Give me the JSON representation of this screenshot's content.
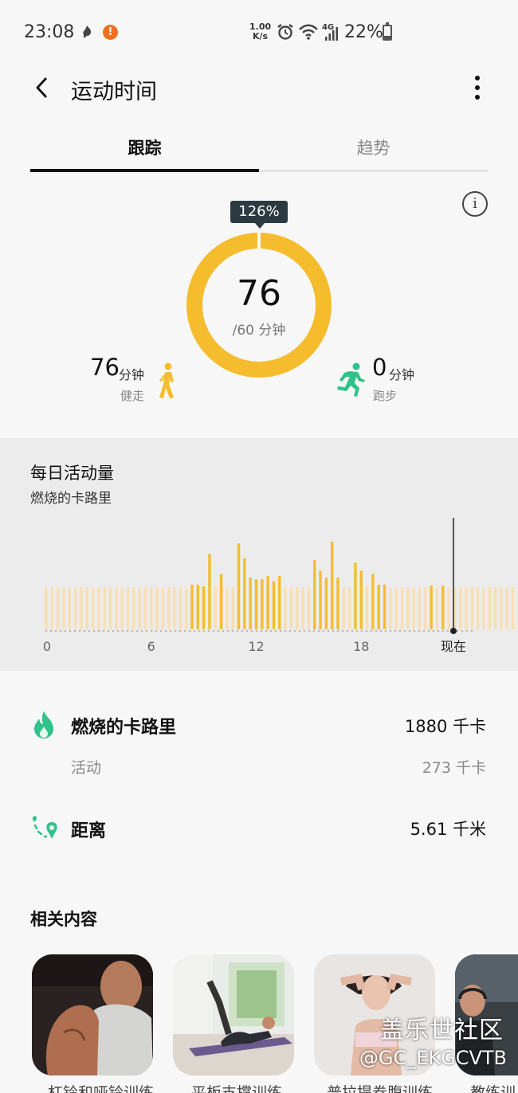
{
  "status_bar": {
    "time": "23:08",
    "speed_value": "1.00",
    "speed_unit": "K/s",
    "network": "4G",
    "battery_percent": "22%",
    "battery_level": 0.22,
    "alert_glyph": "!"
  },
  "header": {
    "title": "运动时间",
    "back_icon": "chevron-left-icon",
    "menu_icon": "more-vertical-icon"
  },
  "tabs": [
    {
      "label": "跟踪",
      "active": true
    },
    {
      "label": "趋势",
      "active": false
    }
  ],
  "summary": {
    "percent_badge": "126%",
    "value": "76",
    "goal": "/60 分钟",
    "progress": 1.26,
    "info_glyph": "i",
    "walk": {
      "value": "76",
      "unit": "分钟",
      "label": "健走"
    },
    "run": {
      "value": "0",
      "unit": "分钟",
      "label": "跑步"
    },
    "colors": {
      "ring": "#f5bd2e",
      "walk_icon": "#f5bd2e",
      "run_icon": "#2fc28a",
      "badge": "#2c3a42"
    }
  },
  "daily_activity": {
    "title": "每日活动量",
    "subtitle": "燃烧的卡路里",
    "chart_data": {
      "type": "bar",
      "x_tick_labels": [
        "0",
        "6",
        "12",
        "18",
        "现在"
      ],
      "x_ticks_hours": [
        0,
        6,
        12,
        18,
        23
      ],
      "bar_interval_minutes": 20,
      "bar_heights_relative": [
        0.48,
        0.48,
        0.48,
        0.48,
        0.48,
        0.48,
        0.48,
        0.48,
        0.48,
        0.48,
        0.48,
        0.48,
        0.48,
        0.48,
        0.48,
        0.48,
        0.48,
        0.48,
        0.48,
        0.48,
        0.48,
        0.48,
        0.48,
        0.48,
        0.48,
        0.51,
        0.51,
        0.49,
        0.86,
        0.48,
        0.63,
        0.48,
        0.48,
        0.98,
        0.81,
        0.59,
        0.57,
        0.57,
        0.61,
        0.55,
        0.61,
        0.48,
        0.48,
        0.48,
        0.48,
        0.48,
        0.79,
        0.67,
        0.59,
        1.0,
        0.59,
        0.48,
        0.48,
        0.76,
        0.67,
        0.48,
        0.63,
        0.51,
        0.51,
        0.48,
        0.48,
        0.48,
        0.48,
        0.48,
        0.48,
        0.48,
        0.5,
        0.48,
        0.5,
        0.48,
        0.48,
        0.48,
        0.48,
        0.48,
        0.48,
        0.48,
        0.48,
        0.48,
        0.48,
        0.48,
        0.48,
        0.48,
        0.48,
        0.48
      ],
      "highlighted_bars": [
        25,
        26,
        27,
        28,
        30,
        33,
        34,
        35,
        36,
        37,
        38,
        39,
        40,
        46,
        47,
        48,
        49,
        50,
        53,
        54,
        56,
        57,
        58,
        66,
        68
      ],
      "colors": {
        "active": "#f5bd2e",
        "inactive": "#f8dfb4",
        "now_line": "#222222"
      }
    }
  },
  "details": {
    "calories": {
      "label": "燃烧的卡路里",
      "value": "1880 千卡",
      "icon": "fire-icon"
    },
    "active": {
      "label": "活动",
      "value": "273 千卡"
    },
    "distance": {
      "label": "距离",
      "value": "5.61 千米",
      "icon": "route-icon"
    },
    "colors": {
      "icon_green": "#2fc28a"
    }
  },
  "related": {
    "title": "相关内容",
    "items": [
      {
        "caption": "杠铃和哑铃训练"
      },
      {
        "caption": "平板支撑训练"
      },
      {
        "caption": "普拉提卷腹训练"
      },
      {
        "caption": "教练训练"
      }
    ]
  },
  "watermark": {
    "line1": "盖乐世社区",
    "line2": "@GC_EKGCVTB"
  }
}
